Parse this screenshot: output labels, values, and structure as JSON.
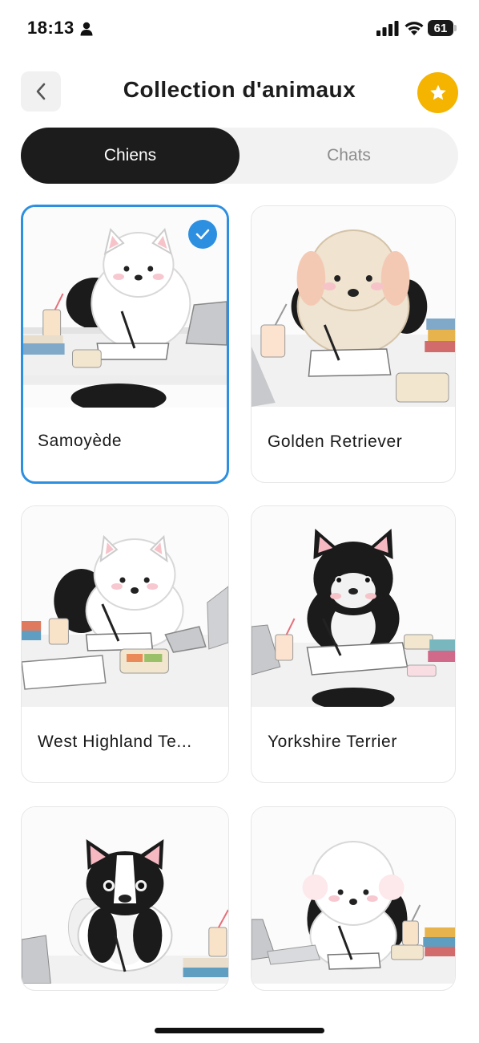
{
  "status_bar": {
    "time": "18:13",
    "battery": "61"
  },
  "header": {
    "title": "Collection d'animaux",
    "back_icon": "chevron-left-icon",
    "favorite_icon": "star-icon"
  },
  "tabs": [
    {
      "label": "Chiens",
      "active": true
    },
    {
      "label": "Chats",
      "active": false
    }
  ],
  "breeds": [
    {
      "name": "Samoyède",
      "selected": true
    },
    {
      "name": "Golden Retriever",
      "selected": false
    },
    {
      "name": "West Highland Te...",
      "selected": false
    },
    {
      "name": "Yorkshire Terrier",
      "selected": false
    },
    {
      "name": "",
      "selected": false
    },
    {
      "name": "",
      "selected": false
    }
  ],
  "colors": {
    "accent": "#2d8fe0",
    "favorite": "#f4b400",
    "active_tab": "#1c1c1c"
  }
}
